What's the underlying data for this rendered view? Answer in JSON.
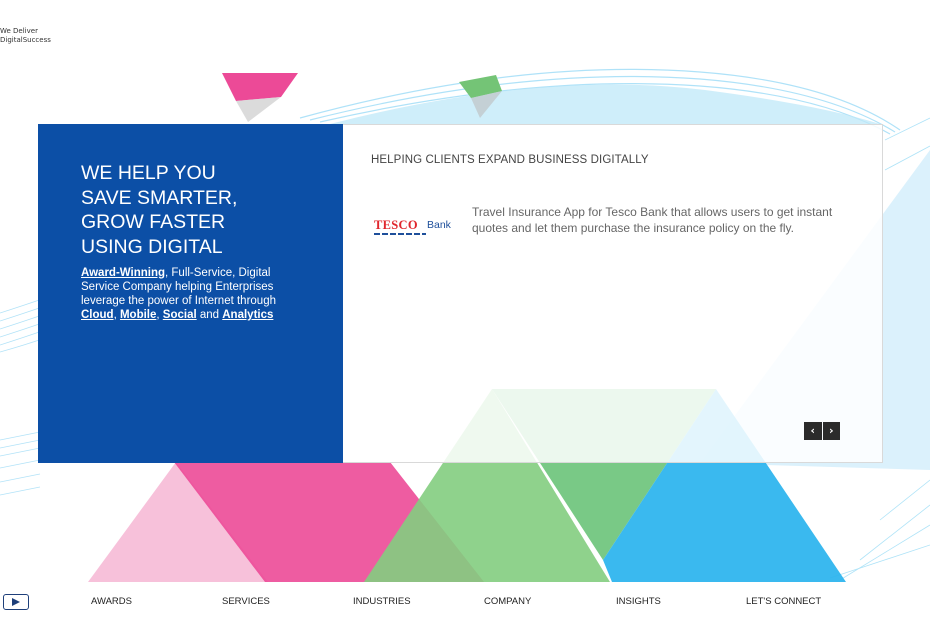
{
  "brand": {
    "tagline_line1": "We Deliver",
    "tagline_line2": "DigitalSuccess"
  },
  "hero": {
    "title_lines": [
      "WE HELP YOU",
      "SAVE SMARTER,",
      "GROW FASTER",
      "USING DIGITAL"
    ],
    "desc_link_award": "Award-Winning",
    "desc_text_1": ", Full-Service, Digital Service Company helping Enterprises leverage the power of Internet through ",
    "desc_link_cloud": "Cloud",
    "desc_sep_1": ", ",
    "desc_link_mobile": "Mobile",
    "desc_sep_2": ", ",
    "desc_link_social": "Social",
    "desc_text_and": " and ",
    "desc_link_analytics": "Analytics"
  },
  "clients": {
    "heading": "HELPING CLIENTS EXPAND BUSINESS DIGITALLY",
    "logo_brand": "TESCO",
    "logo_sub": "Bank",
    "description": "Travel Insurance App for Tesco Bank that allows users to get instant quotes and let them purchase the insurance policy on the fly.",
    "prev_label": "‹",
    "next_label": "›"
  },
  "footer_nav": [
    "AWARDS",
    "SERVICES",
    "INDUSTRIES",
    "COMPANY",
    "INSIGHTS",
    "LET'S CONNECT"
  ],
  "colors": {
    "panel_blue": "#0c4fa6",
    "pink": "#ec4a97",
    "light_pink": "#f6bad6",
    "green": "#74c476",
    "cyan": "#29b3ee",
    "light_cyan": "#bfe8f8",
    "tesco_red": "#e0262d",
    "tesco_blue": "#1e4f9b"
  },
  "icons": {
    "play": "play-icon",
    "prev": "chevron-left-icon",
    "next": "chevron-right-icon"
  }
}
